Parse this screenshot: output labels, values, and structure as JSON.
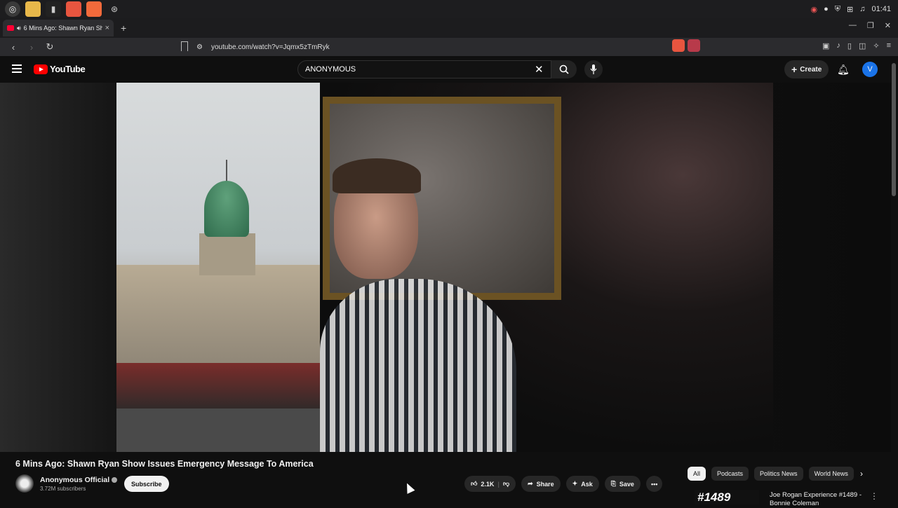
{
  "os": {
    "clock": "01:41"
  },
  "browser": {
    "tab_title": "6 Mins Ago: Shawn Ryan Sh",
    "tab_close": "×",
    "new_tab": "+",
    "url": "youtube.com/watch?v=Jqmx5zTmRyk"
  },
  "youtube": {
    "logo_text": "YouTube",
    "search_value": "ANONYMOUS",
    "create_label": "Create",
    "avatar_letter": "V"
  },
  "video": {
    "title": "6 Mins Ago: Shawn Ryan Show Issues Emergency Message To America",
    "channel_name": "Anonymous Official",
    "subscribers": "3.72M subscribers",
    "subscribe_label": "Subscribe",
    "likes": "2.1K",
    "share_label": "Share",
    "ask_label": "Ask",
    "save_label": "Save"
  },
  "chips": [
    "All",
    "Podcasts",
    "Politics News",
    "World News"
  ],
  "recommendation": {
    "thumb_text": "#1489",
    "title": "Joe Rogan Experience #1489 - Bonnie Coleman"
  },
  "colors": {
    "accent_red": "#ff0000",
    "avatar_blue": "#1a73e8"
  }
}
